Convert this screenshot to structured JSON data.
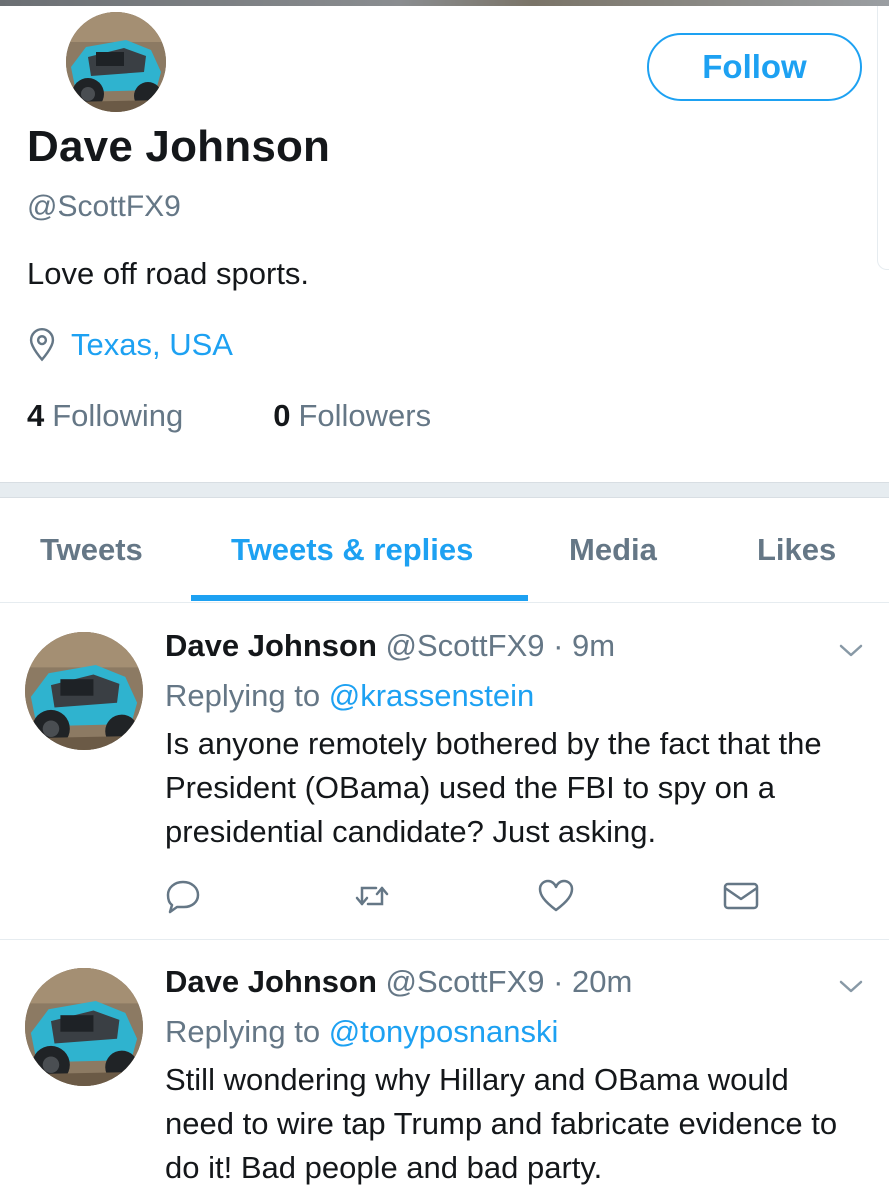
{
  "profile": {
    "name": "Dave Johnson",
    "handle": "@ScottFX9",
    "bio": "Love off road sports.",
    "location": "Texas, USA",
    "following_count": "4",
    "following_label": "Following",
    "followers_count": "0",
    "followers_label": "Followers",
    "follow_button": "Follow"
  },
  "tabs": [
    {
      "label": "Tweets"
    },
    {
      "label": "Tweets & replies",
      "active": true
    },
    {
      "label": "Media"
    },
    {
      "label": "Likes"
    }
  ],
  "tweets": [
    {
      "name": "Dave Johnson",
      "meta": "@ScottFX9 · 9m",
      "replying_label": "Replying to",
      "replying_to": "@krassenstein",
      "text": "Is anyone remotely bothered by the fact that the President (OBama) used the FBI to spy on a presidential candidate? Just asking."
    },
    {
      "name": "Dave Johnson",
      "meta": "@ScottFX9 · 20m",
      "replying_label": "Replying to",
      "replying_to": "@tonyposnanski",
      "text": "Still wondering why Hillary and OBama would need to wire tap Trump and fabricate evidence to do it! Bad people and bad party."
    }
  ],
  "colors": {
    "accent": "#1da1f2",
    "secondary_text": "#657786",
    "primary_text": "#14171a"
  },
  "icons": [
    "location-pin-icon",
    "chevron-down-icon",
    "reply-icon",
    "retweet-icon",
    "like-icon",
    "direct-message-icon"
  ]
}
